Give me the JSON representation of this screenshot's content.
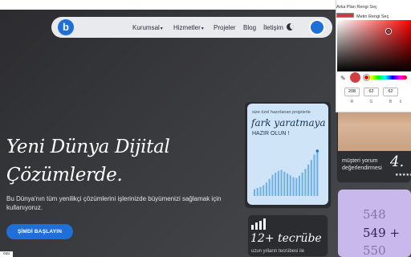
{
  "nav": {
    "logo_letter": "b",
    "items": [
      {
        "label": "Kurumsal",
        "chevron": "chevron-down-icon"
      },
      {
        "label": "Hizmetler",
        "chevron": "chevron-down-icon"
      },
      {
        "label": "Projeler"
      },
      {
        "label": "Blog"
      },
      {
        "label": "İletişim"
      }
    ],
    "theme_icon": "moon-icon"
  },
  "hero": {
    "title_line1": "Yeni Dünya Dijital",
    "title_line2": "Çözümlerde.",
    "description": "Bu Dünya'nın tüm yenilikçi çözümlerini işlerinizde büyümenizi sağlamak için kullanıyoruz.",
    "cta_label": "ŞİMDİ BAŞLAYIN"
  },
  "chart_card": {
    "small_text": "size özel hazırlanan projelerle",
    "big_text": "fark yaratmaya",
    "ready_text": "HAZIR OLUN !"
  },
  "chart_data": {
    "type": "bar",
    "values": [
      15,
      18,
      20,
      24,
      30,
      38,
      47,
      52,
      56,
      58,
      54,
      50,
      46,
      42,
      40,
      45,
      52,
      60,
      70,
      80,
      92,
      100
    ],
    "color": "#6fb0e8"
  },
  "review_card": {
    "stat": "4.",
    "label": "müşteri yorum değerlendirmesi",
    "stars": "★★★★★"
  },
  "counter_card": {
    "lines": [
      "548",
      "549 +",
      "550"
    ]
  },
  "experience_card": {
    "title": "12+ tecrübe",
    "subtitle": "uzun yılların tecrübesi ile"
  },
  "corner_tag": "ouu",
  "color_picker": {
    "bg_label": "Arka Plan Rengi Seç",
    "text_label": "Metin Rengi Seç",
    "bg_swatch": "#cc3a3a",
    "text_swatch": "#ffffff",
    "selected_color": "#d03e3e",
    "r": "208",
    "g": "62",
    "b": "62",
    "r_label": "R",
    "g_label": "G",
    "b_label": "B",
    "toggle": "⇕"
  }
}
